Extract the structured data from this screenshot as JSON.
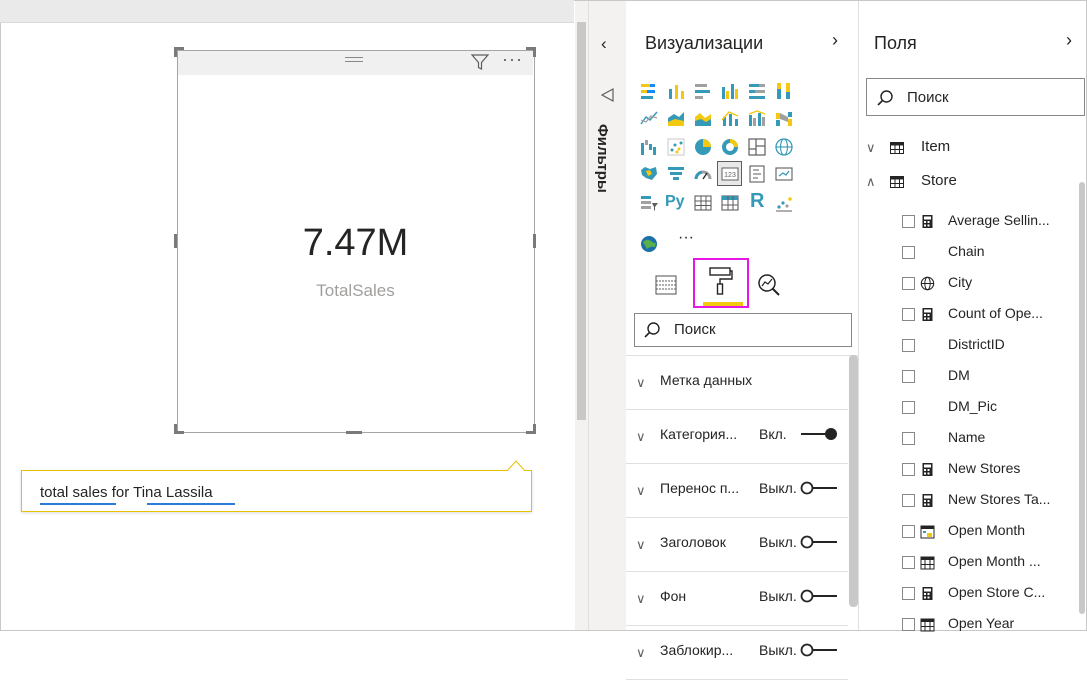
{
  "canvas": {
    "card": {
      "value": "7.47M",
      "label": "TotalSales",
      "more_label": "···"
    },
    "qa": {
      "text": "total sales for Tina Lassila",
      "underlined": [
        "total sales",
        "Tina Lassila"
      ]
    }
  },
  "filters_pane": {
    "title": "Фильтры",
    "collapse_glyph": "‹"
  },
  "visualizations": {
    "title": "Визуализации",
    "chevron": "›",
    "icons": [
      "stacked-bar-icon",
      "stacked-column-icon",
      "clustered-bar-icon",
      "clustered-column-icon",
      "100-stacked-bar-icon",
      "100-stacked-column-icon",
      "line-chart-icon",
      "area-chart-icon",
      "stacked-area-icon",
      "line-column-icon",
      "line-clustered-column-icon",
      "ribbon-chart-icon",
      "waterfall-icon",
      "scatter-icon",
      "pie-icon",
      "donut-icon",
      "treemap-icon",
      "map-icon",
      "filled-map-icon",
      "funnel-icon",
      "gauge-icon",
      "card-icon",
      "multi-row-card-icon",
      "kpi-icon",
      "slicer-icon",
      "python-visual-icon",
      "table-icon",
      "matrix-icon",
      "r-visual-icon",
      "key-influencers-icon",
      "arcgis-icon",
      "more-visuals-icon"
    ],
    "python_label": "Py",
    "r_label": "R",
    "more_label": "···",
    "search_placeholder": "Поиск",
    "sections": [
      {
        "title": "Метка данных",
        "state": "",
        "toggle": null
      },
      {
        "title": "Категория...",
        "state": "Вкл.",
        "toggle": "on"
      },
      {
        "title": "Перенос п...",
        "state": "Выкл.",
        "toggle": "off"
      },
      {
        "title": "Заголовок",
        "state": "Выкл.",
        "toggle": "off"
      },
      {
        "title": "Фон",
        "state": "Выкл.",
        "toggle": "off"
      },
      {
        "title": "Заблокир...",
        "state": "Выкл.",
        "toggle": "off"
      }
    ],
    "chevron_down_glyph": "∨"
  },
  "fields": {
    "title": "Поля",
    "chevron": "›",
    "search_placeholder": "Поиск",
    "tables": [
      {
        "name": "Item",
        "expanded": false,
        "chevron": "∨"
      },
      {
        "name": "Store",
        "expanded": true,
        "chevron": "∧"
      }
    ],
    "store_fields": [
      {
        "label": "Average Sellin...",
        "icon": "calculator-icon"
      },
      {
        "label": "Chain",
        "icon": ""
      },
      {
        "label": "City",
        "icon": "globe-icon"
      },
      {
        "label": "Count of Ope...",
        "icon": "calculator-icon"
      },
      {
        "label": "DistrictID",
        "icon": ""
      },
      {
        "label": "DM",
        "icon": ""
      },
      {
        "label": "DM_Pic",
        "icon": ""
      },
      {
        "label": "Name",
        "icon": ""
      },
      {
        "label": "New Stores",
        "icon": "calculator-icon"
      },
      {
        "label": "New Stores Ta...",
        "icon": "calculator-icon"
      },
      {
        "label": "Open Month",
        "icon": "date-hierarchy-icon"
      },
      {
        "label": "Open Month ...",
        "icon": "calendar-icon"
      },
      {
        "label": "Open Store C...",
        "icon": "calculator-icon"
      },
      {
        "label": "Open Year",
        "icon": "calendar-icon"
      }
    ]
  },
  "colors": {
    "accent_yellow": "#f2c811",
    "highlight_magenta": "#e616e6",
    "qa_border": "#e8c200",
    "link_underline": "#2b7bd9"
  }
}
